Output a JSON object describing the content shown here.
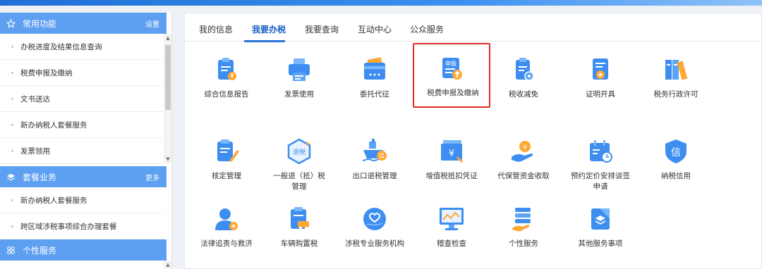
{
  "sidebar": {
    "common": {
      "title": "常用功能",
      "action": "设置",
      "icon": "star-icon"
    },
    "common_items": [
      {
        "label": "办税进度及结果信息查询"
      },
      {
        "label": "税费申报及缴纳"
      },
      {
        "label": "文书送达"
      },
      {
        "label": "新办纳税人套餐服务"
      },
      {
        "label": "发票领用"
      }
    ],
    "package": {
      "title": "套餐业务",
      "action": "更多",
      "icon": "layers-icon"
    },
    "package_items": [
      {
        "label": "新办纳税人套餐服务"
      },
      {
        "label": "跨区域涉税事项综合办理套餐"
      }
    ],
    "personal": {
      "title": "个性服务",
      "icon": "grid-icon"
    }
  },
  "tabs": [
    {
      "label": "我的信息"
    },
    {
      "label": "我要办税"
    },
    {
      "label": "我要查询"
    },
    {
      "label": "互动中心"
    },
    {
      "label": "公众服务"
    }
  ],
  "tiles": [
    {
      "label": "综合信息报告",
      "icon": "report-icon"
    },
    {
      "label": "发票使用",
      "icon": "printer-icon"
    },
    {
      "label": "委托代征",
      "icon": "card-icon"
    },
    {
      "label": "税费申报及缴纳",
      "icon": "declare-icon",
      "badge": "申报"
    },
    {
      "label": "税收减免",
      "icon": "tax-relief-icon"
    },
    {
      "label": "证明开具",
      "icon": "certificate-icon"
    },
    {
      "label": "税务行政许可",
      "icon": "books-icon"
    },
    {
      "label": "核定管理",
      "icon": "clipboard-edit-icon"
    },
    {
      "label": "一般退（抵）税管理",
      "icon": "refund-icon",
      "badge": "退税"
    },
    {
      "label": "出口退税管理",
      "icon": "ship-icon"
    },
    {
      "label": "增值税抵扣凭证",
      "icon": "voucher-icon"
    },
    {
      "label": "代保管资金收取",
      "icon": "money-hand-icon"
    },
    {
      "label": "预约定价安排谈签申请",
      "icon": "calendar-clock-icon"
    },
    {
      "label": "纳税信用",
      "icon": "credit-icon",
      "badge": "信"
    },
    {
      "label": "法律追责与救济",
      "icon": "judge-icon"
    },
    {
      "label": "车辆购置税",
      "icon": "vehicle-tax-icon"
    },
    {
      "label": "涉税专业服务机构",
      "icon": "service-org-icon"
    },
    {
      "label": "稽查检查",
      "icon": "inspection-icon"
    },
    {
      "label": "个性服务",
      "icon": "personal-service-icon"
    },
    {
      "label": "其他服务事项",
      "icon": "other-service-icon"
    }
  ],
  "colors": {
    "accent": "#2e74d8",
    "sidebar_head": "#5d9ff0",
    "highlight": "#e02b26"
  }
}
